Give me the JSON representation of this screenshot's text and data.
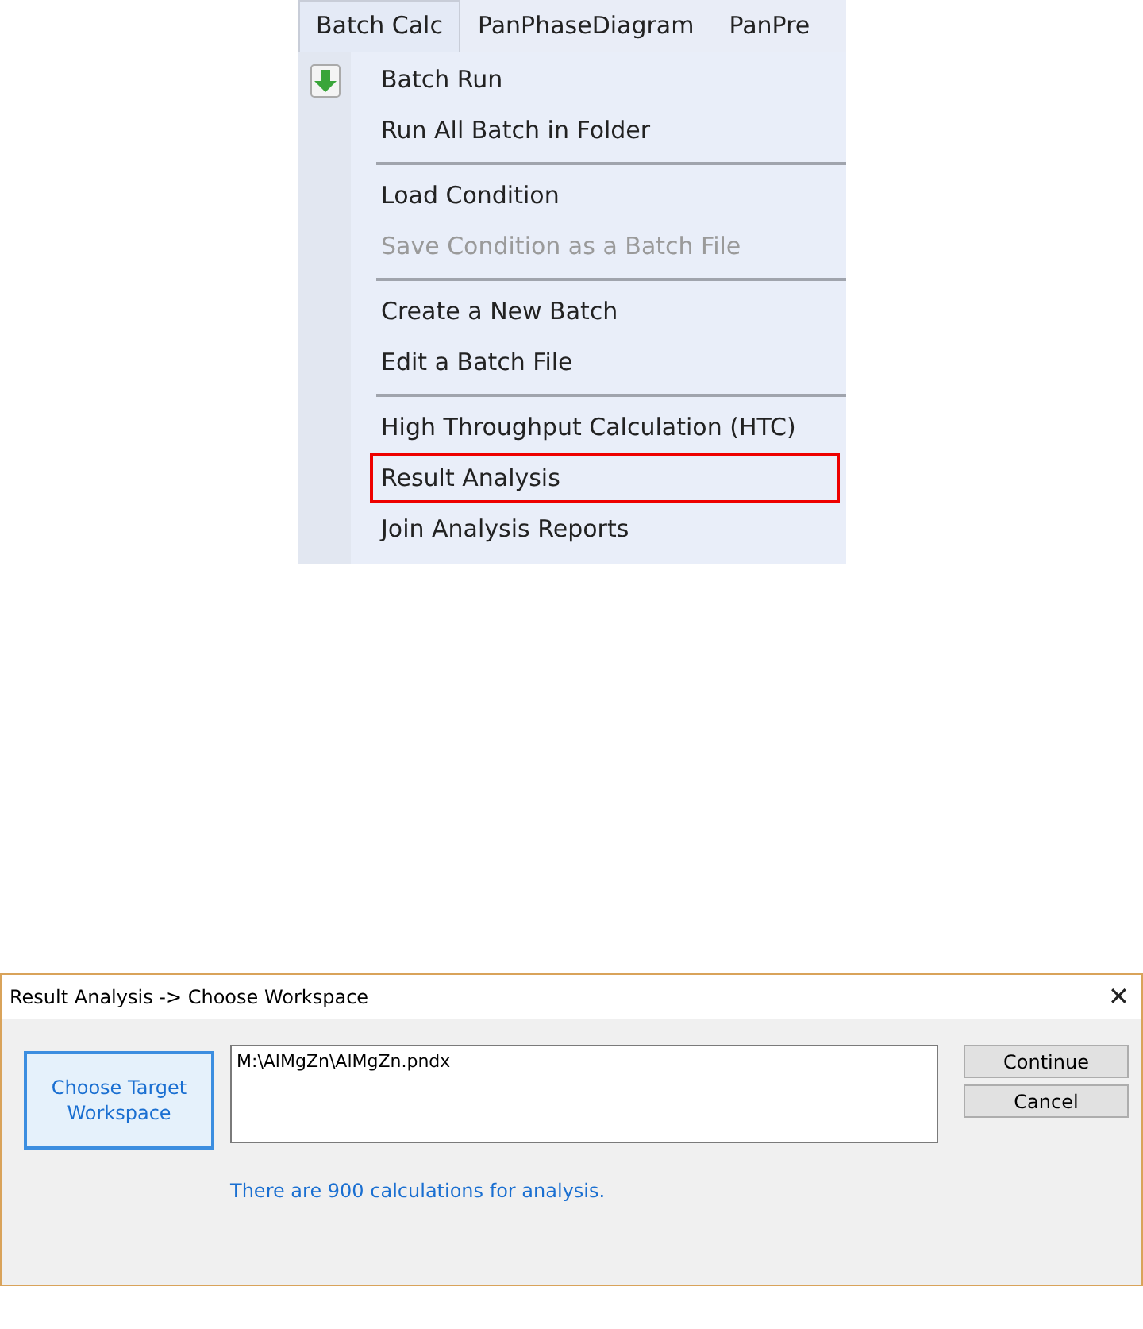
{
  "menu": {
    "tabs": [
      {
        "label": "Batch Calc",
        "selected": true
      },
      {
        "label": "PanPhaseDiagram",
        "selected": false
      },
      {
        "label": "PanPre",
        "selected": false
      }
    ],
    "items": [
      {
        "kind": "item",
        "label": "Batch Run",
        "icon": true,
        "disabled": false,
        "highlighted": false
      },
      {
        "kind": "item",
        "label": "Run All Batch in Folder",
        "icon": false,
        "disabled": false,
        "highlighted": false
      },
      {
        "kind": "separator"
      },
      {
        "kind": "item",
        "label": "Load Condition",
        "icon": false,
        "disabled": false,
        "highlighted": false
      },
      {
        "kind": "item",
        "label": "Save Condition as a Batch File",
        "icon": false,
        "disabled": true,
        "highlighted": false
      },
      {
        "kind": "separator"
      },
      {
        "kind": "item",
        "label": "Create a New Batch",
        "icon": false,
        "disabled": false,
        "highlighted": false
      },
      {
        "kind": "item",
        "label": "Edit a Batch File",
        "icon": false,
        "disabled": false,
        "highlighted": false
      },
      {
        "kind": "separator"
      },
      {
        "kind": "item",
        "label": "High Throughput Calculation (HTC)",
        "icon": false,
        "disabled": false,
        "highlighted": false
      },
      {
        "kind": "item",
        "label": "Result Analysis",
        "icon": false,
        "disabled": false,
        "highlighted": true
      },
      {
        "kind": "item",
        "label": "Join Analysis Reports",
        "icon": false,
        "disabled": false,
        "highlighted": false
      }
    ]
  },
  "dialog": {
    "title": "Result Analysis -> Choose Workspace",
    "close": "✕",
    "choose_button": "Choose Target Workspace",
    "path": "M:\\AlMgZn\\AlMgZn.pndx",
    "message": "There are 900 calculations for analysis.",
    "buttons": [
      "Continue",
      "Cancel"
    ]
  }
}
